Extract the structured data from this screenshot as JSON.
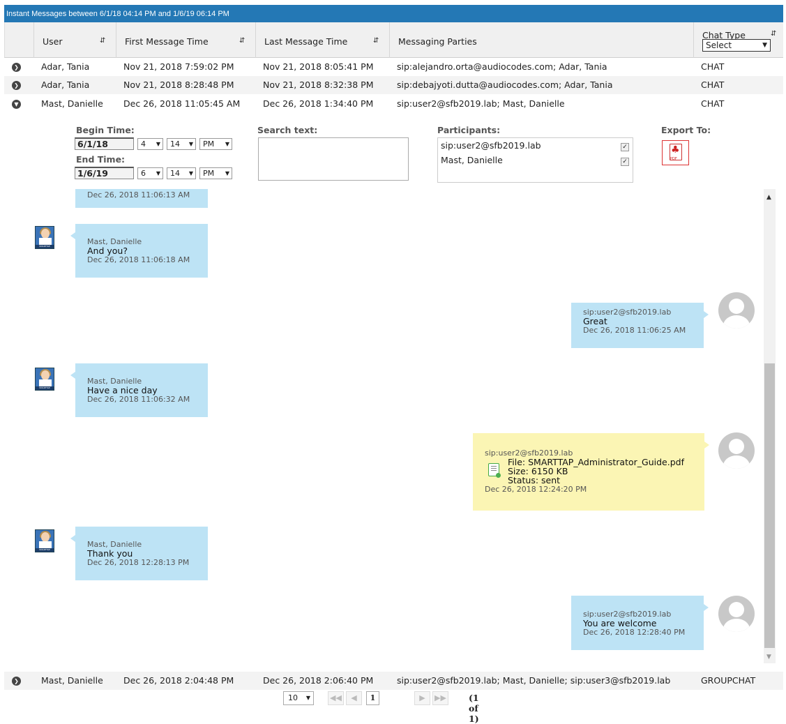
{
  "title": "Instant Messages between 6/1/18 04:14 PM and 1/6/19 06:14 PM",
  "columns": {
    "user": "User",
    "first": "First Message Time",
    "last": "Last Message Time",
    "parties": "Messaging Parties",
    "chat_type": "Chat Type",
    "chat_type_select": "Select"
  },
  "icons": {
    "sort": "sort-arrows-icon",
    "expand": "chevron-right-circle-icon",
    "collapse": "chevron-down-circle-icon"
  },
  "rows": [
    {
      "user": "Adar, Tania",
      "first": "Nov 21, 2018 7:59:02 PM",
      "last": "Nov 21, 2018 8:05:41 PM",
      "parties": "sip:alejandro.orta@audiocodes.com; Adar, Tania",
      "type": "CHAT"
    },
    {
      "user": "Adar, Tania",
      "first": "Nov 21, 2018 8:28:48 PM",
      "last": "Nov 21, 2018 8:32:38 PM",
      "parties": "sip:debajyoti.dutta@audiocodes.com; Adar, Tania",
      "type": "CHAT"
    },
    {
      "user": "Mast, Danielle",
      "first": "Dec 26, 2018 11:05:45 AM",
      "last": "Dec 26, 2018 1:34:40 PM",
      "parties": "sip:user2@sfb2019.lab; Mast, Danielle",
      "type": "CHAT"
    },
    {
      "user": "Mast, Danielle",
      "first": "Dec 26, 2018 2:04:48 PM",
      "last": "Dec 26, 2018 2:06:40 PM",
      "parties": "sip:user2@sfb2019.lab; Mast, Danielle; sip:user3@sfb2019.lab",
      "type": "GROUPCHAT"
    }
  ],
  "filters": {
    "begin_label": "Begin Time:",
    "begin_date": "6/1/18",
    "begin_hour": "4",
    "begin_min": "14",
    "begin_ampm": "PM",
    "end_label": "End Time:",
    "end_date": "1/6/19",
    "end_hour": "6",
    "end_min": "14",
    "end_ampm": "PM",
    "search_label": "Search text:",
    "search_value": "",
    "participants_label": "Participants:",
    "participants": [
      "sip:user2@sfb2019.lab",
      "Mast, Danielle"
    ],
    "export_label": "Export To:",
    "export_pdf": "PDF"
  },
  "messages": [
    {
      "when": "Dec 26, 2018 11:06:13 AM"
    },
    {
      "who": "Mast, Danielle",
      "msg": "And you?",
      "when": "Dec 26, 2018 11:06:18 AM"
    },
    {
      "who": "sip:user2@sfb2019.lab",
      "msg": "Great",
      "when": "Dec 26, 2018 11:06:25 AM"
    },
    {
      "who": "Mast, Danielle",
      "msg": "Have a nice day",
      "when": "Dec 26, 2018 11:06:32 AM"
    },
    {
      "who": "sip:user2@sfb2019.lab",
      "file": "File: SMARTTAP_Administrator_Guide.pdf",
      "size": "Size: 6150 KB",
      "status": "Status: sent",
      "when": "Dec 26, 2018 12:24:20 PM"
    },
    {
      "who": "Mast, Danielle",
      "msg": "Thank you",
      "when": "Dec 26, 2018 12:28:13 PM"
    },
    {
      "who": "sip:user2@sfb2019.lab",
      "msg": "You are welcome",
      "when": "Dec 26, 2018 12:28:40 PM"
    }
  ],
  "avatar_band": "SMARTTAP",
  "pager": {
    "page_size": "10",
    "current": "1",
    "info": "(1 of 1)"
  }
}
